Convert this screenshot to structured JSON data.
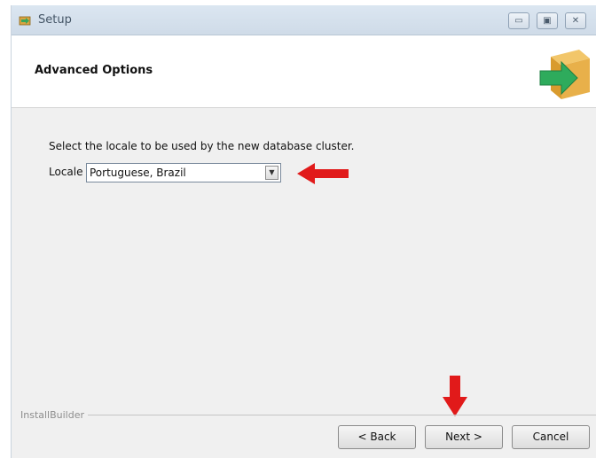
{
  "window": {
    "title": "Setup",
    "minimize_glyph": "▭",
    "maximize_glyph": "▣",
    "close_glyph": "✕"
  },
  "header": {
    "title": "Advanced Options",
    "logo_icon": "installer-box-arrow-icon"
  },
  "body": {
    "instruction": "Select the locale to be used by the new database cluster.",
    "locale_label": "Locale",
    "locale_value": "Portuguese, Brazil",
    "dropdown_glyph": "▼"
  },
  "footer": {
    "brand": "InstallBuilder",
    "back_label": "< Back",
    "next_label": "Next >",
    "cancel_label": "Cancel"
  },
  "annotations": {
    "arrow_color": "#e11a1a",
    "arrow_icons": [
      "red-arrow-left-icon",
      "red-arrow-down-icon"
    ]
  }
}
